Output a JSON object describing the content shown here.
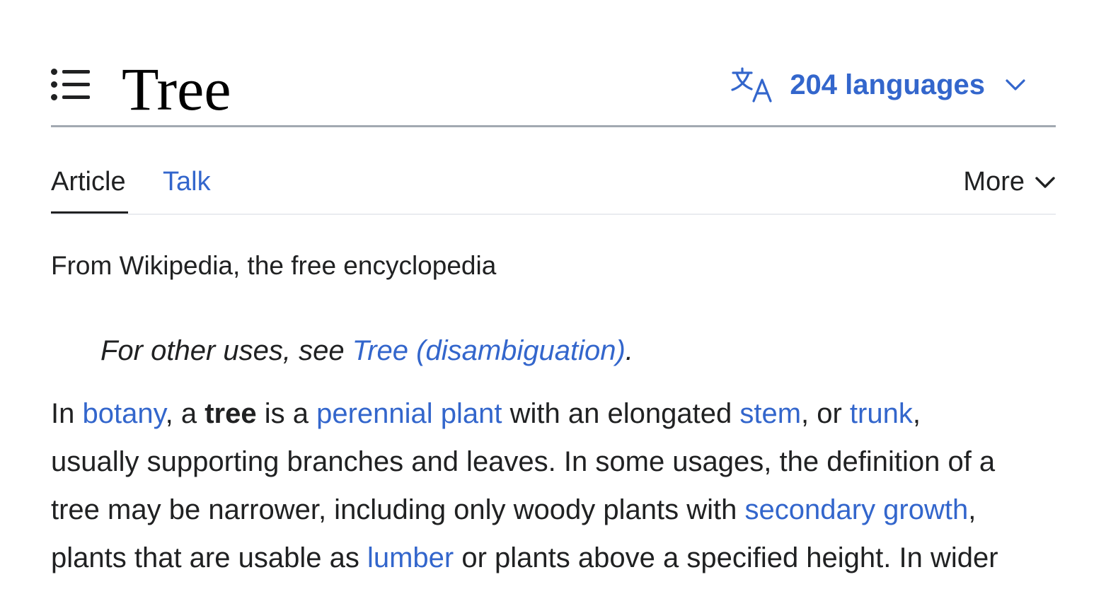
{
  "header": {
    "title": "Tree",
    "languages_label": "204 languages"
  },
  "tabs": {
    "article": "Article",
    "talk": "Talk",
    "more": "More"
  },
  "tagline": "From Wikipedia, the free encyclopedia",
  "hatnote": {
    "prefix": "For other uses, see ",
    "link": "Tree (disambiguation)",
    "suffix": "."
  },
  "paragraph": {
    "l1_t1": "In ",
    "l1_link1": "botany",
    "l1_t2": ", a ",
    "l1_bold": "tree",
    "l1_t3": " is a ",
    "l1_link2": "perennial plant",
    "l1_t4": " with an elongated ",
    "l1_link3": "stem",
    "l1_t5": ", or ",
    "l1_link4": "trunk",
    "l1_t6": ",",
    "l2": "usually supporting branches and leaves. In some usages, the definition of a",
    "l3_t1": "tree may be narrower, including only woody plants with ",
    "l3_link1": "secondary growth",
    "l3_t2": ",",
    "l4_t1": "plants that are usable as ",
    "l4_link1": "lumber",
    "l4_t2": " or plants above a specified height. In wider"
  },
  "icons": {
    "toc": "list-icon",
    "language": "translate-icon",
    "chevron": "chevron-down-icon"
  },
  "colors": {
    "link": "#3366cc",
    "text": "#202122",
    "rule": "#a2a9b1"
  }
}
